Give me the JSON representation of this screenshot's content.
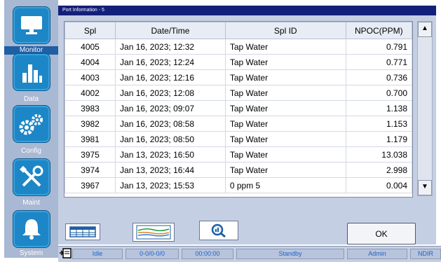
{
  "window": {
    "title": "Port Information - 5"
  },
  "sidebar": {
    "items": [
      {
        "label": "Monitor",
        "icon": "monitor-icon",
        "active": true
      },
      {
        "label": "Data",
        "icon": "bar-chart-icon",
        "active": false
      },
      {
        "label": "Config",
        "icon": "gears-icon",
        "active": false
      },
      {
        "label": "Maint",
        "icon": "tools-icon",
        "active": false
      },
      {
        "label": "System",
        "icon": "bell-icon",
        "active": false
      }
    ]
  },
  "table": {
    "columns": [
      "Spl",
      "Date/Time",
      "Spl ID",
      "NPOC(PPM)"
    ],
    "rows": [
      [
        "4005",
        "Jan 16, 2023; 12:32",
        "Tap Water",
        "0.791"
      ],
      [
        "4004",
        "Jan 16, 2023; 12:24",
        "Tap Water",
        "0.771"
      ],
      [
        "4003",
        "Jan 16, 2023; 12:16",
        "Tap Water",
        "0.736"
      ],
      [
        "4002",
        "Jan 16, 2023; 12:08",
        "Tap Water",
        "0.700"
      ],
      [
        "3983",
        "Jan 16, 2023; 09:07",
        "Tap Water",
        "1.138"
      ],
      [
        "3982",
        "Jan 16, 2023; 08:58",
        "Tap Water",
        "1.153"
      ],
      [
        "3981",
        "Jan 16, 2023; 08:50",
        "Tap Water",
        "1.179"
      ],
      [
        "3975",
        "Jan 13, 2023; 16:50",
        "Tap Water",
        "13.038"
      ],
      [
        "3974",
        "Jan 13, 2023; 16:44",
        "Tap Water",
        "2.998"
      ],
      [
        "3967",
        "Jan 13, 2023; 15:53",
        "0 ppm 5",
        "0.004"
      ]
    ]
  },
  "scrollbar": {
    "up_glyph": "▲",
    "down_glyph": "▼"
  },
  "toolbar": {
    "table_view_icon": "table-icon",
    "graph_view_icon": "graph-icon",
    "details_icon": "magnifier-icon",
    "ok_label": "OK"
  },
  "statusbar": {
    "state": "Idle",
    "port": "0-0/0-0/0",
    "time": "00:00:00",
    "mode": "Standby",
    "user": "Admin",
    "detector": "NDIR"
  },
  "colors": {
    "sidebar_bg": "#a9b8d3",
    "tile_blue": "#1d86c6",
    "titlebar": "#13207a",
    "status_text": "#1f62c6"
  }
}
